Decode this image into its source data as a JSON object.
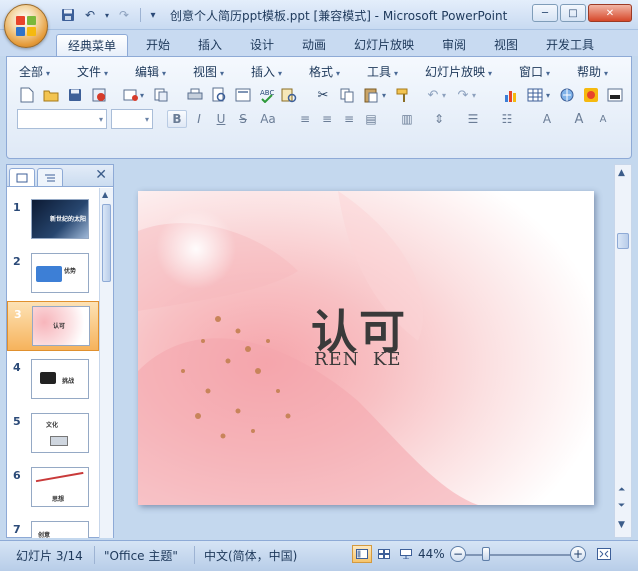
{
  "window": {
    "title": "创意个人简历ppt模板.ppt [兼容模式] - Microsoft PowerPoint",
    "minimize_label": "─",
    "maximize_label": "□",
    "close_label": "✕"
  },
  "ribbon_tabs": [
    {
      "label": "经典菜单",
      "active": true
    },
    {
      "label": "开始"
    },
    {
      "label": "插入"
    },
    {
      "label": "设计"
    },
    {
      "label": "动画"
    },
    {
      "label": "幻灯片放映"
    },
    {
      "label": "审阅"
    },
    {
      "label": "视图"
    },
    {
      "label": "开发工具"
    }
  ],
  "classic_menu": [
    {
      "label": "全部"
    },
    {
      "label": "文件"
    },
    {
      "label": "编辑"
    },
    {
      "label": "视图"
    },
    {
      "label": "插入"
    },
    {
      "label": "格式"
    },
    {
      "label": "工具"
    },
    {
      "label": "幻灯片放映"
    },
    {
      "label": "窗口"
    },
    {
      "label": "帮助"
    }
  ],
  "format_buttons": {
    "bold": "B",
    "italic": "I",
    "underline": "U",
    "strike": "S",
    "case": "Aa",
    "font_color": "A",
    "grow_font": "A",
    "shrink_font": "A"
  },
  "left_panel": {
    "close_label": "✕",
    "slides": [
      {
        "number": "1",
        "text": "新世纪的太阳",
        "theme": "dark"
      },
      {
        "number": "2",
        "text": "优势",
        "theme": "blue"
      },
      {
        "number": "3",
        "text": "认可",
        "theme": "pink",
        "selected": true
      },
      {
        "number": "4",
        "text": "挑战",
        "theme": "plain"
      },
      {
        "number": "5",
        "text": "文化",
        "theme": "plain"
      },
      {
        "number": "6",
        "text": "思想",
        "theme": "red"
      },
      {
        "number": "7",
        "text": "创意",
        "theme": "plain"
      }
    ]
  },
  "slide": {
    "title": "认可",
    "subtitle": "REN  KE"
  },
  "status_bar": {
    "slide_info": "幻灯片 3/14",
    "theme": "\"Office 主题\"",
    "language": "中文(简体，中国)",
    "zoom": "44%",
    "zoom_value": 44,
    "zoom_minus": "−",
    "zoom_plus": "+"
  },
  "colors": {
    "ribbon_blue": "#c4d8ee",
    "selection_orange": "#f6b35c"
  }
}
